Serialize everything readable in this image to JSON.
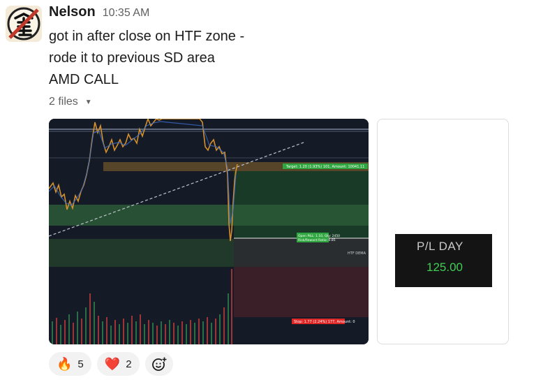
{
  "message": {
    "author": "Nelson",
    "time": "10:35 AM",
    "lines": [
      "got in after close on HTF zone -",
      "rode it to previous SD area",
      "AMD CALL"
    ]
  },
  "files": {
    "toggle_label": "2 files",
    "chart": {
      "target_label": "Target: 1.20 (1.93%) 101, Amount: 10041.11",
      "entry_label_line1": "Open P&L: 1.10, Qty: 2450",
      "entry_label_line2": "Risk/Reward Ratio: 0.85",
      "stop_label": "Stop: 1.77 (2.24%) 177, Amount: 0",
      "zone_label": "HTF DEMA",
      "colors": {
        "background": "#141a26",
        "candle": "#d4902c",
        "target": "#2fa63f",
        "stop": "#e02525"
      }
    },
    "pl": {
      "title": "P/L DAY",
      "value": "125.00"
    }
  },
  "reactions": [
    {
      "emoji": "🔥",
      "count": "5"
    },
    {
      "emoji": "❤️",
      "count": "2"
    }
  ],
  "add_reaction_icon": "add-reaction-icon"
}
